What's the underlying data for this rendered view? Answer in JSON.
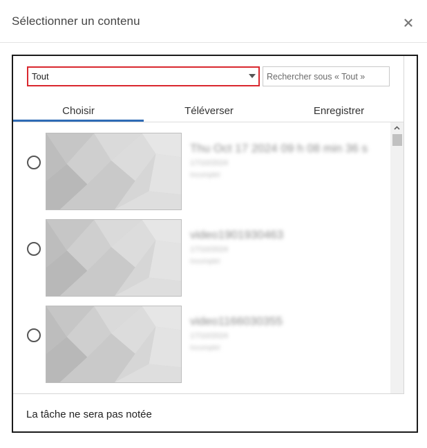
{
  "dialog": {
    "title": "Sélectionner un contenu",
    "close_icon": "close-icon"
  },
  "toolbar": {
    "folder_select": {
      "selected": "Tout"
    },
    "search": {
      "placeholder": "Rechercher sous « Tout »",
      "value": ""
    }
  },
  "tabs": [
    {
      "label": "Choisir",
      "active": true
    },
    {
      "label": "Téléverser",
      "active": false
    },
    {
      "label": "Enregistrer",
      "active": false
    }
  ],
  "items": [
    {
      "title": "Thu Oct 17 2024 09 h 08 min 36 s",
      "date": "17/10/2024",
      "status": "Incomplet"
    },
    {
      "title": "video1901930463",
      "date": "17/10/2024",
      "status": "Incomplet"
    },
    {
      "title": "video1166030355",
      "date": "17/10/2024",
      "status": "Incomplet"
    }
  ],
  "footer": {
    "note": "La tâche ne sera pas notée"
  },
  "colors": {
    "accent": "#2e6bb5",
    "select_border": "#d9272e",
    "frame_border": "#1a1a1a"
  }
}
